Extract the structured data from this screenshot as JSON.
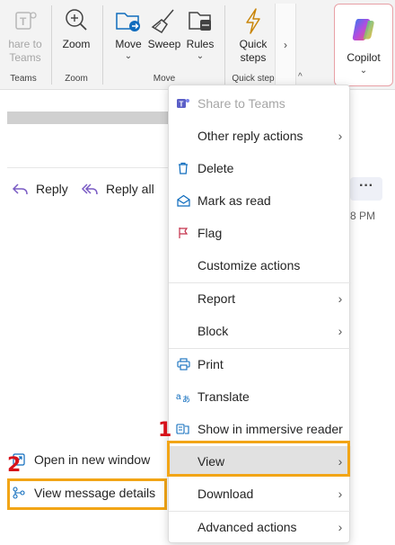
{
  "ribbon": {
    "teams": {
      "label_line1": "hare to",
      "label_line2": "Teams",
      "group": "Teams"
    },
    "zoom": {
      "label": "Zoom",
      "group": "Zoom"
    },
    "move_group": {
      "move": "Move",
      "sweep": "Sweep",
      "rules": "Rules",
      "group": "Move"
    },
    "quick": {
      "label_line1": "Quick",
      "label_line2": "steps",
      "group": "Quick step"
    },
    "copilot": {
      "label": "Copilot"
    }
  },
  "email": {
    "reply": "Reply",
    "reply_all": "Reply all",
    "more": "···",
    "time": "8 PM",
    "open_new_window": "Open in new window",
    "view_message_details": "View message details"
  },
  "markers": {
    "one": "1",
    "two": "2"
  },
  "menu": {
    "items": [
      {
        "label": "Share to Teams"
      },
      {
        "label": "Other reply actions"
      },
      {
        "label": "Delete"
      },
      {
        "label": "Mark as read"
      },
      {
        "label": "Flag"
      },
      {
        "label": "Customize actions"
      },
      {
        "label": "Report"
      },
      {
        "label": "Block"
      },
      {
        "label": "Print"
      },
      {
        "label": "Translate"
      },
      {
        "label": "Show in immersive reader"
      },
      {
        "label": "View"
      },
      {
        "label": "Download"
      },
      {
        "label": "Advanced actions"
      }
    ]
  },
  "colors": {
    "highlight": "#f2a516",
    "marker": "#d6111a",
    "accent": "#0f6cbd"
  }
}
